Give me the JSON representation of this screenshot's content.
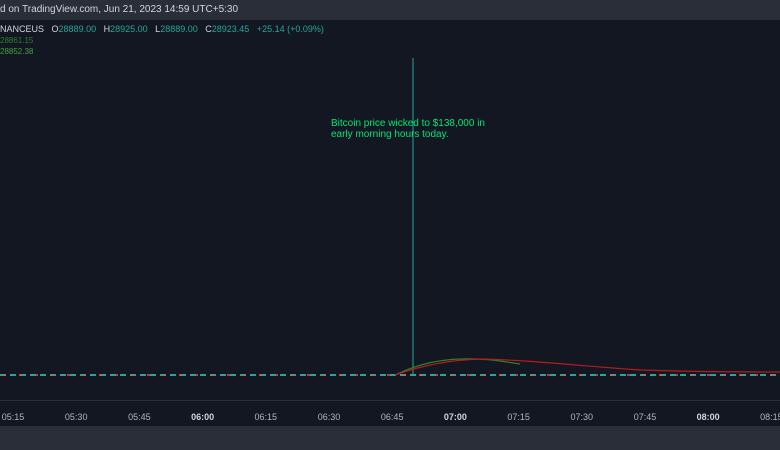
{
  "header": {
    "title": "d on TradingView.com,  Jun 21, 2023 14:59 UTC+5:30"
  },
  "legend": {
    "symbol": "NANCEUS",
    "open_label": "O",
    "open": "28889.00",
    "high_label": "H",
    "high": "28925.00",
    "low_label": "L",
    "low": "28889.00",
    "close_label": "C",
    "close": "28923.45",
    "change": "+25.14 (+0.09%)",
    "ma1": "28861.15",
    "ma2": "28852.38"
  },
  "annotation": {
    "text": "Bitcoin price wicked to $138,000 in early morning hours today."
  },
  "time_axis": {
    "ticks": [
      {
        "label": "05:15",
        "bold": false
      },
      {
        "label": "05:30",
        "bold": false
      },
      {
        "label": "05:45",
        "bold": false
      },
      {
        "label": "06:00",
        "bold": true
      },
      {
        "label": "06:15",
        "bold": false
      },
      {
        "label": "06:30",
        "bold": false
      },
      {
        "label": "06:45",
        "bold": false
      },
      {
        "label": "07:00",
        "bold": true
      },
      {
        "label": "07:15",
        "bold": false
      },
      {
        "label": "07:30",
        "bold": false
      },
      {
        "label": "07:45",
        "bold": false
      },
      {
        "label": "08:00",
        "bold": true
      },
      {
        "label": "08:15",
        "bold": false
      }
    ]
  },
  "colors": {
    "background": "#131722",
    "up": "#26a69a",
    "down": "#ef5350",
    "annotation": "#00e676",
    "ma_green": "#2e7d32",
    "ma_red": "#b71c1c"
  }
}
